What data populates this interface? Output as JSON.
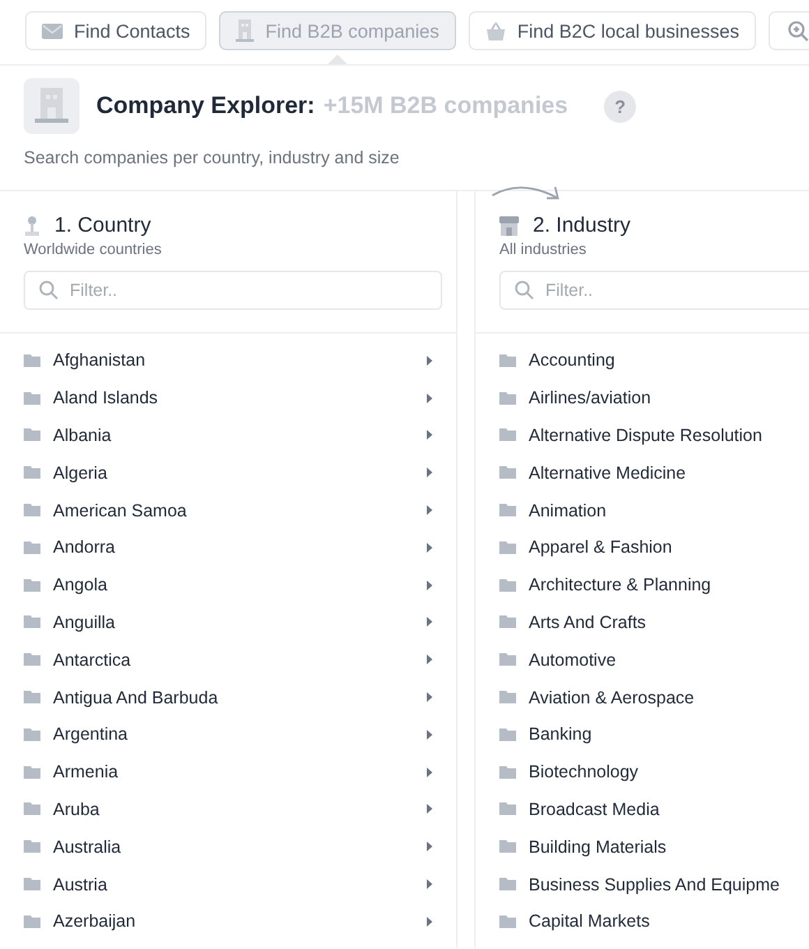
{
  "tabs": [
    {
      "kind": "text",
      "label": "Find Contacts",
      "selected": false
    },
    {
      "kind": "text",
      "label": "Find B2B companies",
      "selected": true
    },
    {
      "kind": "text",
      "label": "Find B2C local businesses",
      "selected": false
    },
    {
      "kind": "icon",
      "selected": false
    }
  ],
  "header": {
    "title": "Company Explorer:",
    "highlight": "+15M B2B companies",
    "help": "?",
    "subtitle": "Search companies per country, industry and size"
  },
  "columns": [
    {
      "title": "1. Country",
      "subtitle": "Worldwide countries",
      "placeholder": "Filter..",
      "expandable": true,
      "items": [
        "Afghanistan",
        "Aland Islands",
        "Albania",
        "Algeria",
        "American Samoa",
        "Andorra",
        "Angola",
        "Anguilla",
        "Antarctica",
        "Antigua And Barbuda",
        "Argentina",
        "Armenia",
        "Aruba",
        "Australia",
        "Austria",
        "Azerbaijan"
      ]
    },
    {
      "title": "2. Industry",
      "subtitle": "All industries",
      "placeholder": "Filter..",
      "expandable": false,
      "items": [
        "Accounting",
        "Airlines/aviation",
        "Alternative Dispute Resolution",
        "Alternative Medicine",
        "Animation",
        "Apparel & Fashion",
        "Architecture & Planning",
        "Arts And Crafts",
        "Automotive",
        "Aviation & Aerospace",
        "Banking",
        "Biotechnology",
        "Broadcast Media",
        "Building Materials",
        "Business Supplies And Equipme",
        "Capital Markets"
      ]
    }
  ]
}
